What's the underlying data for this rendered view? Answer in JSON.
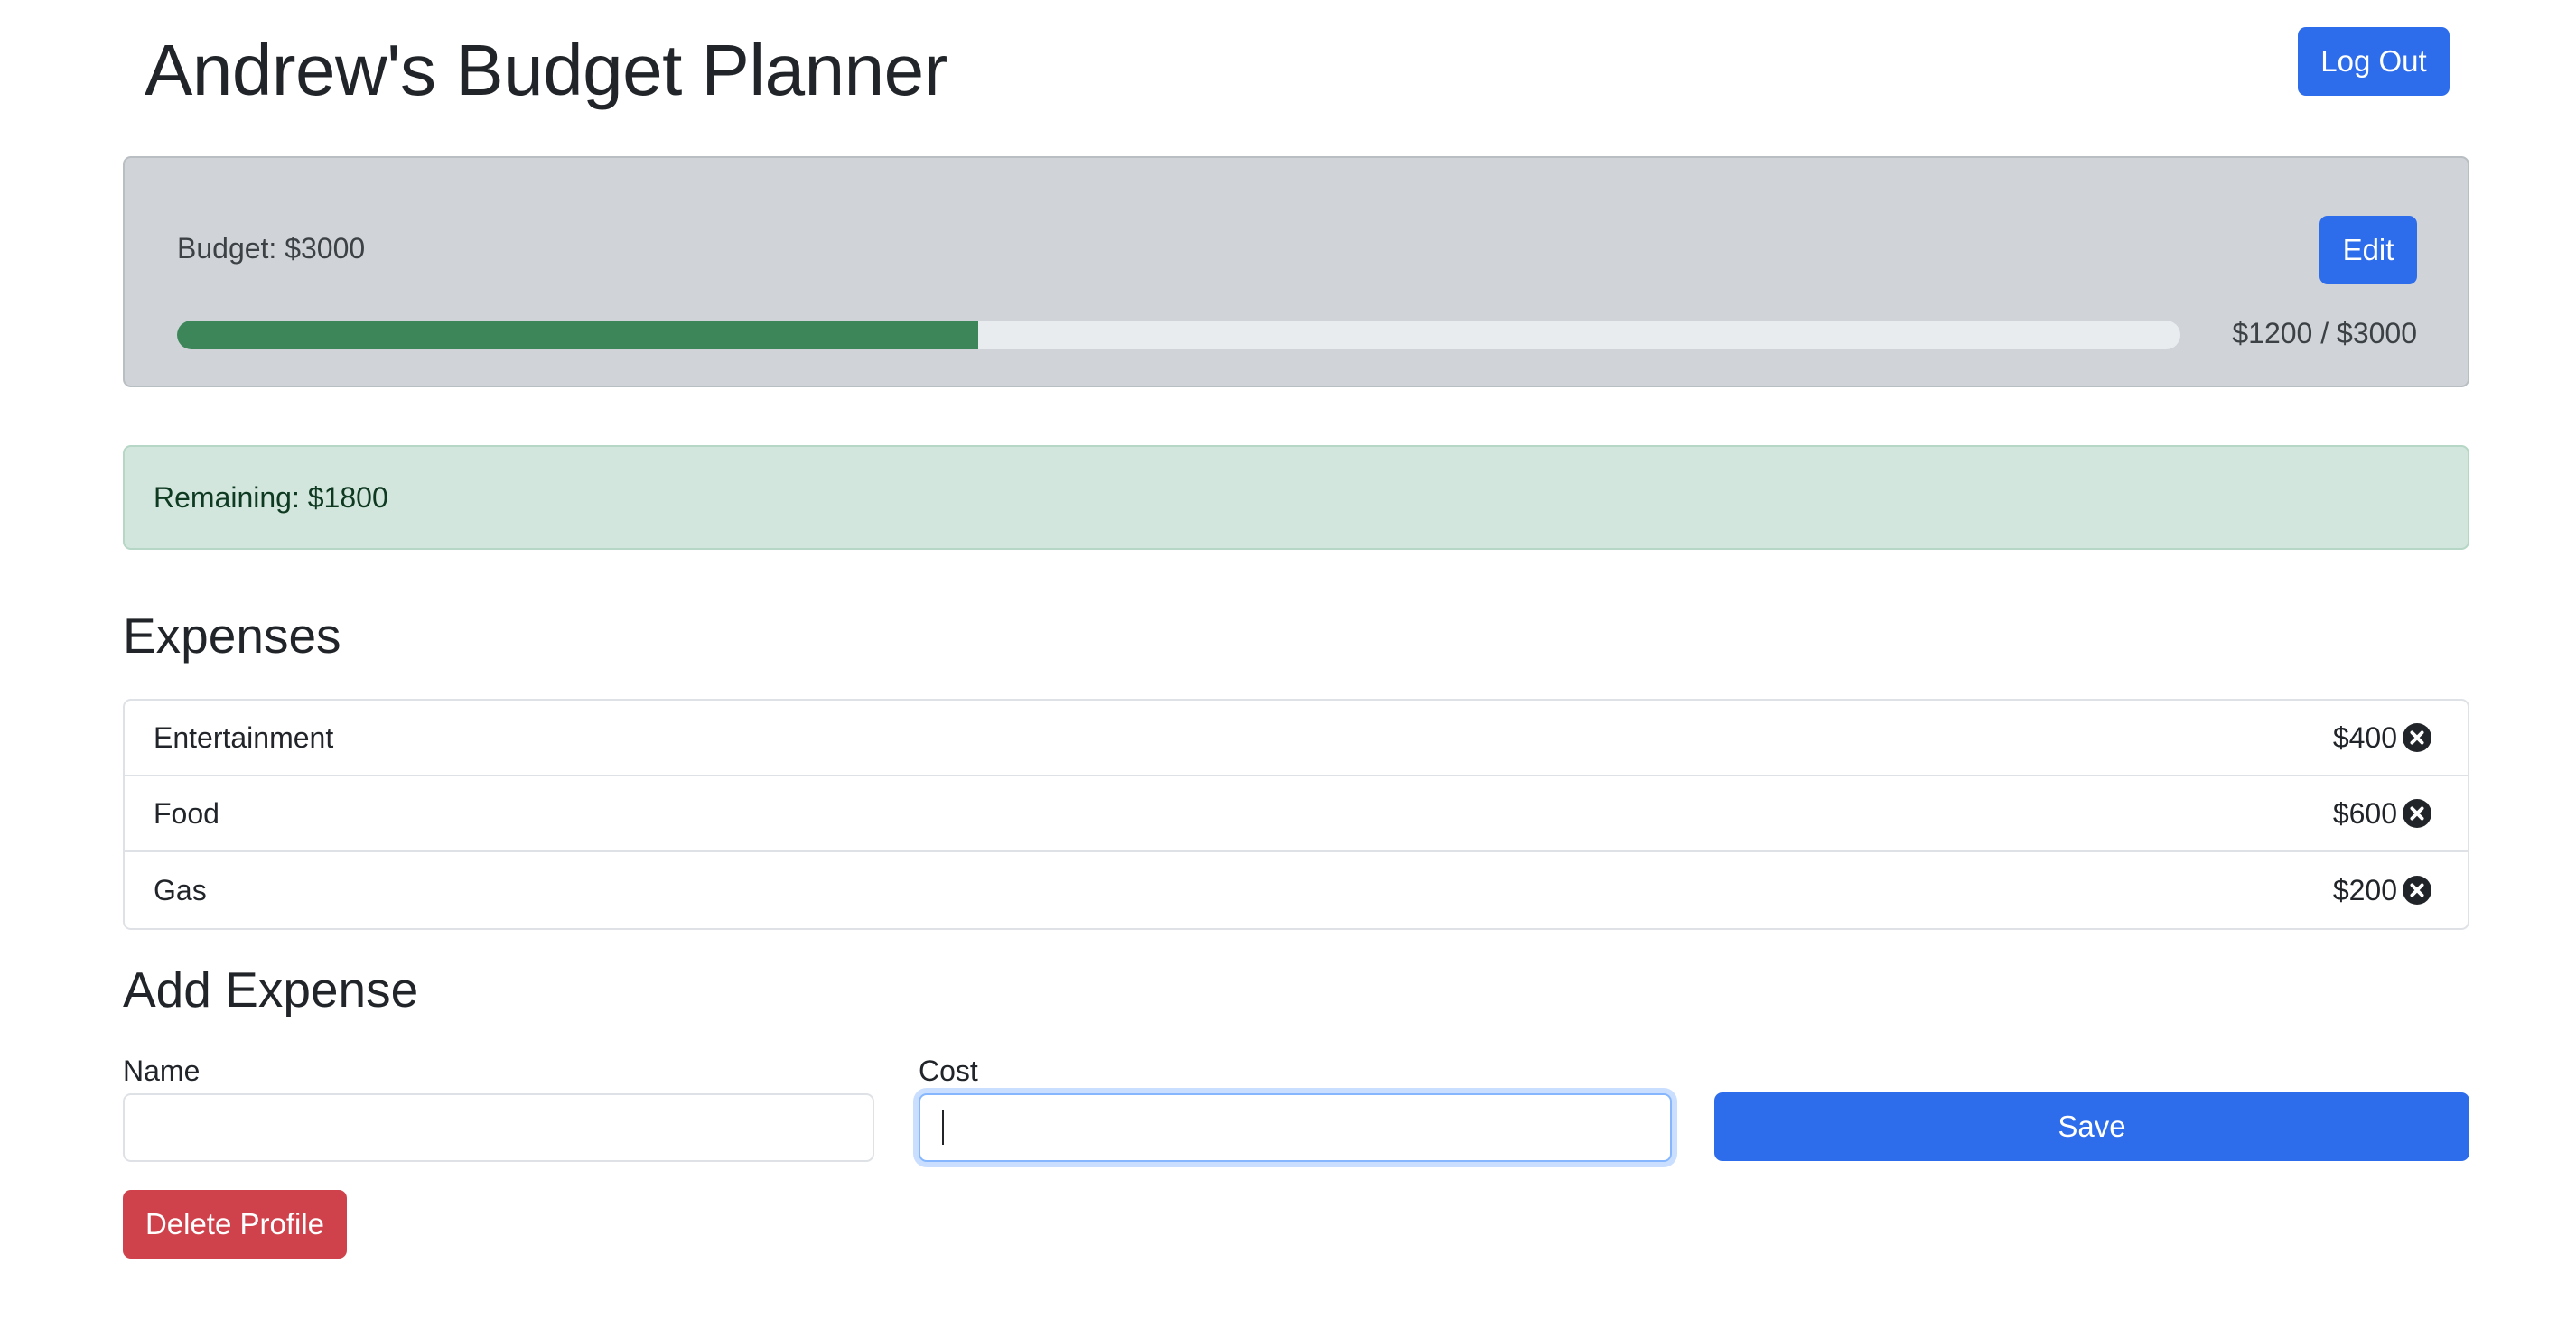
{
  "header": {
    "title": "Andrew's Budget Planner",
    "logout_label": "Log Out"
  },
  "budget": {
    "label": "Budget: $3000",
    "edit_label": "Edit",
    "spent_fraction": 0.4,
    "progress_text": "$1200 / $3000",
    "progress_color": "#3d865a"
  },
  "remaining": {
    "text": "Remaining: $1800"
  },
  "expenses": {
    "heading": "Expenses",
    "items": [
      {
        "name": "Entertainment",
        "cost": "$400"
      },
      {
        "name": "Food",
        "cost": "$600"
      },
      {
        "name": "Gas",
        "cost": "$200"
      }
    ],
    "remove_icon": "close-circle-icon"
  },
  "add_expense": {
    "heading": "Add Expense",
    "name_label": "Name",
    "name_value": "",
    "cost_label": "Cost",
    "cost_value": "",
    "save_label": "Save"
  },
  "profile": {
    "delete_label": "Delete Profile"
  },
  "colors": {
    "primary": "#2d6ceb",
    "danger": "#cf424c",
    "success_bg": "#d3e6dd",
    "card_bg": "#d0d4d8"
  }
}
